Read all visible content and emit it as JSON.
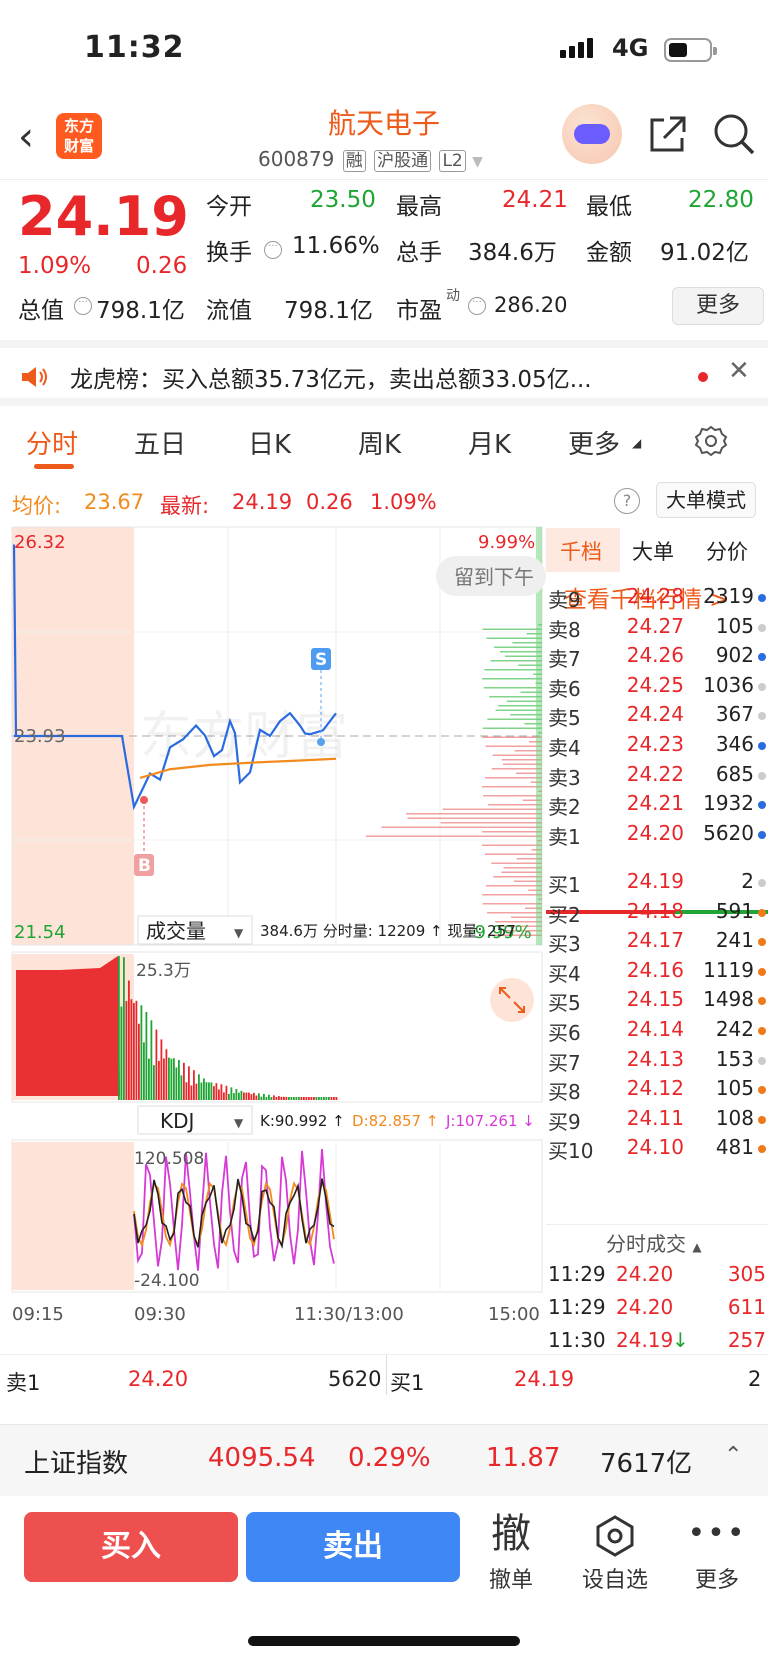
{
  "status": {
    "time": "11:32",
    "network": "4G"
  },
  "header": {
    "logo_text_1": "东方",
    "logo_text_2": "财富",
    "stock_name": "航天电子",
    "code": "600879",
    "tags": [
      "融",
      "沪股通",
      "L2"
    ]
  },
  "quote": {
    "price": "24.19",
    "pct": "1.09%",
    "change": "0.26",
    "open_label": "今开",
    "open": "23.50",
    "high_label": "最高",
    "high": "24.21",
    "low_label": "最低",
    "low": "22.80",
    "turnover_label": "换手",
    "turnover": "11.66%",
    "volume_label": "总手",
    "volume": "384.6万",
    "amount_label": "金额",
    "amount": "91.02亿",
    "mktcap_label": "总值",
    "mktcap": "798.1亿",
    "float_label": "流值",
    "float": "798.1亿",
    "pe_label": "市盈",
    "pe_sup": "动",
    "pe": "286.20",
    "more": "更多"
  },
  "notice": {
    "text": "龙虎榜：买入总额35.73亿元，卖出总额33.05亿..."
  },
  "tabs": [
    "分时",
    "五日",
    "日K",
    "周K",
    "月K",
    "更多"
  ],
  "avg_row": {
    "avg_label": "均价:",
    "avg": "23.67",
    "last_label": "最新:",
    "last": "24.19",
    "chg": "0.26",
    "pct": "1.09%",
    "mode_btn": "大单模式"
  },
  "chart": {
    "y_top": "26.32",
    "y_mid": "23.93",
    "y_bottom": "21.54",
    "pct_top": "9.99%",
    "pct_bottom": "-9.99%",
    "stay_tip": "留到下午",
    "watermark": "东方财富",
    "volume_selector": "成交量",
    "volume_info": "384.6万 分时量: 12209 ↑ 现量: 257",
    "volume_peak": "25.3万",
    "kdj_selector": "KDJ",
    "kdj_k": "K:90.992 ↑",
    "kdj_d": "D:82.857 ↑",
    "kdj_j": "J:107.261 ↓",
    "kdj_top": "120.508",
    "kdj_bottom": "-24.100",
    "x_labels": [
      "09:15",
      "09:30",
      "11:30/13:00",
      "15:00"
    ],
    "marker_buy": "B",
    "marker_sell": "S"
  },
  "chart_data": {
    "type": "line",
    "title": "",
    "ylabel": "",
    "ylim": [
      21.54,
      26.32
    ],
    "x": [
      "09:15",
      "09:30",
      "11:30/13:00",
      "15:00"
    ],
    "series": [
      {
        "values": [
          23.93,
          23.93,
          23.12,
          23.5,
          23.8,
          24.05,
          23.7,
          24.1,
          23.4,
          24.0,
          24.1,
          24.05,
          23.95,
          24.19
        ]
      },
      {
        "values": [
          23.45,
          23.55,
          23.6,
          23.63,
          23.65,
          23.67
        ]
      }
    ]
  },
  "book": {
    "tabs": [
      "千档",
      "大单",
      "分价"
    ],
    "link": "查看千档行情 >",
    "asks": [
      {
        "label": "卖9",
        "price": "24.28",
        "vol": "2319",
        "dot": "#2a6be0"
      },
      {
        "label": "卖8",
        "price": "24.27",
        "vol": "105",
        "dot": "#ccc"
      },
      {
        "label": "卖7",
        "price": "24.26",
        "vol": "902",
        "dot": "#2a6be0"
      },
      {
        "label": "卖6",
        "price": "24.25",
        "vol": "1036",
        "dot": "#ccc"
      },
      {
        "label": "卖5",
        "price": "24.24",
        "vol": "367",
        "dot": "#ccc"
      },
      {
        "label": "卖4",
        "price": "24.23",
        "vol": "346",
        "dot": "#2a6be0"
      },
      {
        "label": "卖3",
        "price": "24.22",
        "vol": "685",
        "dot": "#ccc"
      },
      {
        "label": "卖2",
        "price": "24.21",
        "vol": "1932",
        "dot": "#2a6be0"
      },
      {
        "label": "卖1",
        "price": "24.20",
        "vol": "5620",
        "dot": "#2a6be0"
      }
    ],
    "bids": [
      {
        "label": "买1",
        "price": "24.19",
        "vol": "2",
        "dot": "#ccc"
      },
      {
        "label": "买2",
        "price": "24.18",
        "vol": "591",
        "dot": "#f07a1a"
      },
      {
        "label": "买3",
        "price": "24.17",
        "vol": "241",
        "dot": "#f07a1a"
      },
      {
        "label": "买4",
        "price": "24.16",
        "vol": "1119",
        "dot": "#f07a1a"
      },
      {
        "label": "买5",
        "price": "24.15",
        "vol": "1498",
        "dot": "#f07a1a"
      },
      {
        "label": "买6",
        "price": "24.14",
        "vol": "242",
        "dot": "#f07a1a"
      },
      {
        "label": "买7",
        "price": "24.13",
        "vol": "153",
        "dot": "#ccc"
      },
      {
        "label": "买8",
        "price": "24.12",
        "vol": "105",
        "dot": "#f07a1a"
      },
      {
        "label": "买9",
        "price": "24.11",
        "vol": "108",
        "dot": "#f07a1a"
      },
      {
        "label": "买10",
        "price": "24.10",
        "vol": "481",
        "dot": "#f07a1a"
      }
    ],
    "trades_title": "分时成交",
    "trades": [
      {
        "time": "11:29",
        "price": "24.20",
        "vol": "305",
        "arrow": ""
      },
      {
        "time": "11:29",
        "price": "24.20",
        "vol": "611",
        "arrow": ""
      },
      {
        "time": "11:30",
        "price": "24.19",
        "vol": "257",
        "arrow": "↓"
      }
    ]
  },
  "bottom_row": {
    "sell1_label": "卖1",
    "sell1_price": "24.20",
    "sell1_vol": "5620",
    "buy1_label": "买1",
    "buy1_price": "24.19",
    "buy1_vol": "2"
  },
  "index_bar": {
    "name": "上证指数",
    "value": "4095.54",
    "pct": "0.29%",
    "chg": "11.87",
    "amount": "7617亿"
  },
  "actions": {
    "buy": "买入",
    "sell": "卖出",
    "cancel_icon": "撤",
    "cancel": "撤单",
    "watch": "设自选",
    "more": "更多"
  },
  "colors": {
    "up": "#e8272b",
    "down": "#1ea533",
    "accent": "#ee5a19",
    "avg": "#f28a1e",
    "price_line": "#2a6be0"
  }
}
